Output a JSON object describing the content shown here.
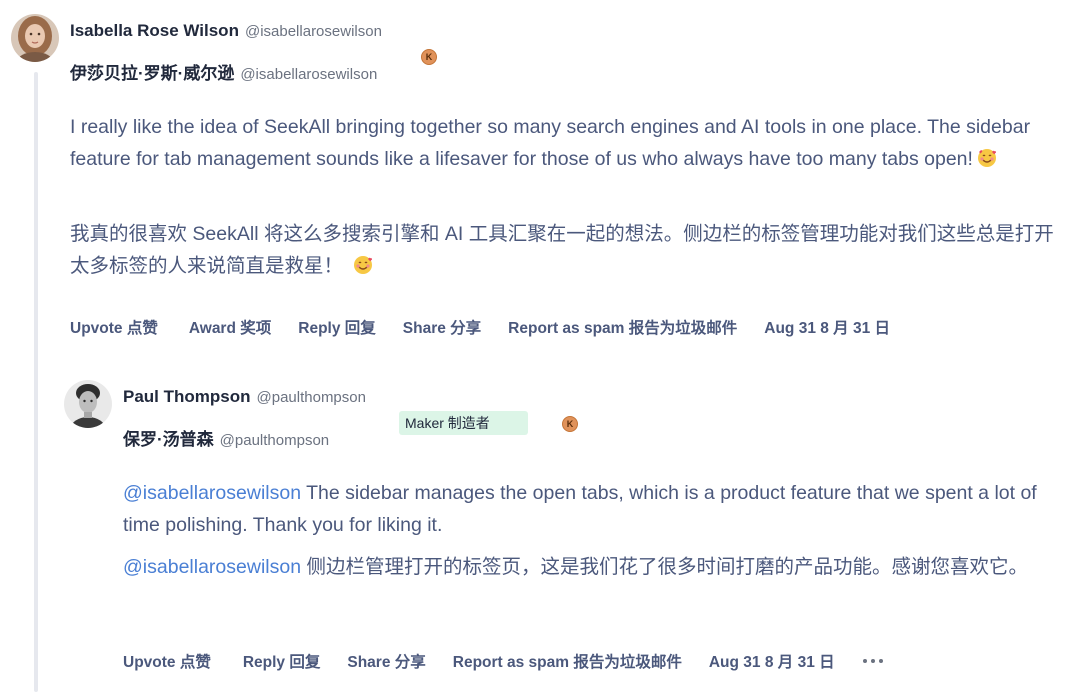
{
  "comments": [
    {
      "author_name": "Isabella Rose Wilson",
      "author_handle": "@isabellarosewilson",
      "author_name_cn": "伊莎贝拉·罗斯·威尔逊",
      "author_handle_cn": "@isabellarosewilson",
      "karma_badge": "K",
      "body_en": "I really like the idea of SeekAll bringing together so many search engines and AI tools in one place. The sidebar feature for tab management sounds like a lifesaver for those of us who always have too many tabs open!",
      "body_cn": "我真的很喜欢 SeekAll 将这么多搜索引擎和 AI 工具汇聚在一起的想法。侧边栏的标签管理功能对我们这些总是打开太多标签的人来说简直是救星！",
      "emoji": "smiling-face-with-hearts",
      "actions": {
        "upvote": "Upvote 点赞",
        "award": "Award 奖项",
        "reply": "Reply 回复",
        "share": "Share 分享",
        "report": "Report as spam 报告为垃圾邮件",
        "date": "Aug 31 8 月 31 日"
      }
    },
    {
      "author_name": "Paul Thompson",
      "author_handle": "@paulthompson",
      "author_name_cn": "保罗·汤普森",
      "author_handle_cn": "@paulthompson",
      "maker_badge": "Maker 制造者",
      "karma_badge": "K",
      "mention": "@isabellarosewilson",
      "body_en": " The sidebar manages the open tabs, which is a product feature that we spent a lot of time polishing. Thank you for liking it.",
      "mention_cn": "@isabellarosewilson",
      "body_cn": " 侧边栏管理打开的标签页，这是我们花了很多时间打磨的产品功能。感谢您喜欢它。",
      "actions": {
        "upvote": "Upvote 点赞",
        "reply": "Reply 回复",
        "share": "Share 分享",
        "report": "Report as spam 报告为垃圾邮件",
        "date": "Aug 31 8 月 31 日"
      }
    }
  ],
  "colors": {
    "text": "#4b587c",
    "name": "#21293c",
    "mention": "#4a7fd4",
    "maker_badge_bg": "#dcf5e7",
    "karma_badge": "#e0925a",
    "thread_line": "#e6e8ee"
  }
}
